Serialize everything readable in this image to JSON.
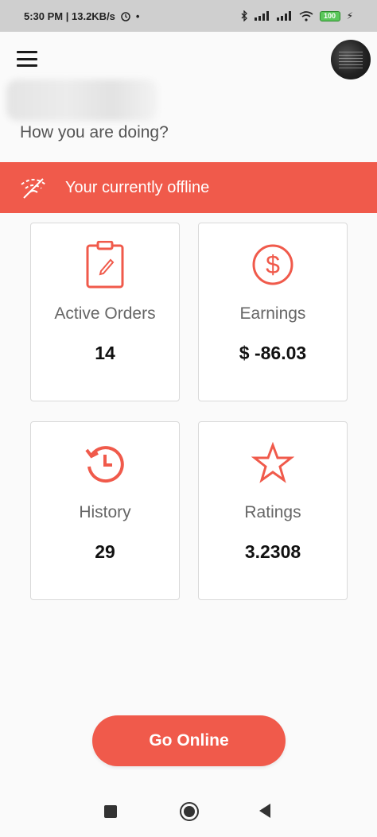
{
  "status_bar": {
    "time_speed": "5:30 PM | 13.2KB/s",
    "battery": "100"
  },
  "header": {
    "menu_icon": "hamburger-menu-icon",
    "avatar": "profile-avatar"
  },
  "greeting": {
    "subtitle": "How you are doing?"
  },
  "banner": {
    "icon": "wifi-off-icon",
    "message": "Your currently offline",
    "color": "#f05a4b"
  },
  "cards": {
    "active_orders": {
      "label": "Active Orders",
      "value": "14",
      "icon": "clipboard-icon"
    },
    "earnings": {
      "label": "Earnings",
      "value": "$ -86.03",
      "icon": "dollar-circle-icon"
    },
    "history": {
      "label": "History",
      "value": "29",
      "icon": "history-clock-icon"
    },
    "ratings": {
      "label": "Ratings",
      "value": "3.2308",
      "icon": "star-icon"
    }
  },
  "actions": {
    "go_online_label": "Go Online"
  },
  "accent_color": "#f05a4b"
}
